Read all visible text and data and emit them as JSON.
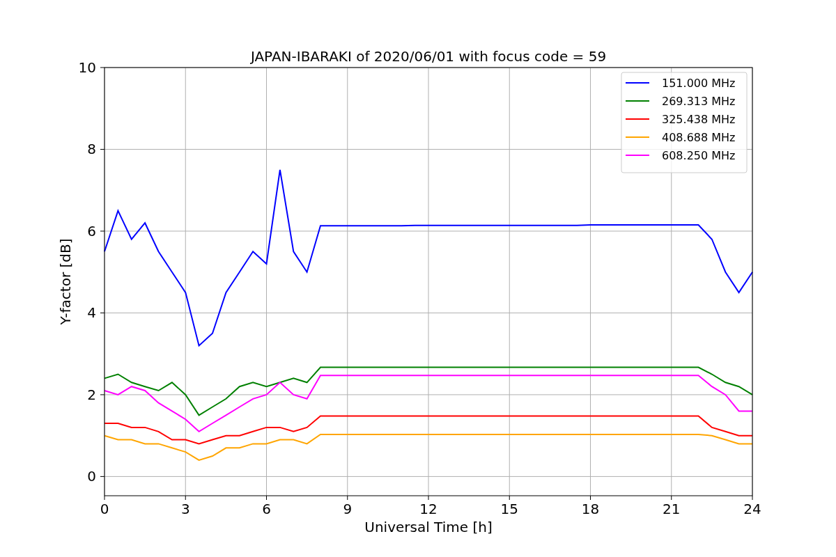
{
  "chart_data": {
    "type": "line",
    "title": "JAPAN-IBARAKI of 2020/06/01 with focus code = 59",
    "xlabel": "Universal Time [h]",
    "ylabel": "Y-factor [dB]",
    "x": [
      0,
      0.5,
      1,
      1.5,
      2,
      2.5,
      3,
      3.5,
      4,
      4.5,
      5,
      5.5,
      6,
      6.5,
      7,
      7.5,
      8,
      8.5,
      9,
      9.5,
      10,
      10.5,
      11,
      11.5,
      12,
      12.5,
      13,
      13.5,
      14,
      14.5,
      15,
      15.5,
      16,
      16.5,
      17,
      17.5,
      18,
      18.5,
      19,
      19.5,
      20,
      20.5,
      21,
      21.5,
      22,
      22.5,
      23,
      23.5,
      24
    ],
    "xlim": [
      0,
      24
    ],
    "ylim": [
      -0.47,
      10
    ],
    "grid": true,
    "legend": true,
    "xticks": [
      0,
      3,
      6,
      9,
      12,
      15,
      18,
      21,
      24
    ],
    "yticks": [
      0,
      2,
      4,
      6,
      8,
      10
    ],
    "series": [
      {
        "name": "151.000 MHz",
        "color": "#0000ff",
        "values": [
          5.5,
          6.5,
          5.8,
          6.2,
          5.5,
          5.0,
          4.5,
          3.2,
          3.5,
          4.5,
          5.0,
          5.5,
          5.2,
          7.5,
          5.5,
          5.0,
          6.13,
          6.13,
          6.13,
          6.13,
          6.13,
          6.13,
          6.13,
          6.14,
          6.14,
          6.14,
          6.14,
          6.14,
          6.14,
          6.14,
          6.14,
          6.14,
          6.14,
          6.14,
          6.14,
          6.14,
          6.15,
          6.15,
          6.15,
          6.15,
          6.15,
          6.15,
          6.15,
          6.15,
          6.15,
          5.8,
          5.0,
          4.5,
          5.0
        ]
      },
      {
        "name": "269.313 MHz",
        "color": "#008000",
        "values": [
          2.4,
          2.5,
          2.3,
          2.2,
          2.1,
          2.3,
          2.0,
          1.5,
          1.7,
          1.9,
          2.2,
          2.3,
          2.2,
          2.3,
          2.4,
          2.3,
          2.67,
          2.67,
          2.67,
          2.67,
          2.67,
          2.67,
          2.67,
          2.67,
          2.67,
          2.67,
          2.67,
          2.67,
          2.67,
          2.67,
          2.67,
          2.67,
          2.67,
          2.67,
          2.67,
          2.67,
          2.67,
          2.67,
          2.67,
          2.67,
          2.67,
          2.67,
          2.67,
          2.67,
          2.67,
          2.5,
          2.3,
          2.2,
          2.0
        ]
      },
      {
        "name": "325.438 MHz",
        "color": "#ff0000",
        "values": [
          1.3,
          1.3,
          1.2,
          1.2,
          1.1,
          0.9,
          0.9,
          0.8,
          0.9,
          1.0,
          1.0,
          1.1,
          1.2,
          1.2,
          1.1,
          1.2,
          1.48,
          1.48,
          1.48,
          1.48,
          1.48,
          1.48,
          1.48,
          1.48,
          1.48,
          1.48,
          1.48,
          1.48,
          1.48,
          1.48,
          1.48,
          1.48,
          1.48,
          1.48,
          1.48,
          1.48,
          1.48,
          1.48,
          1.48,
          1.48,
          1.48,
          1.48,
          1.48,
          1.48,
          1.48,
          1.2,
          1.1,
          1.0,
          1.0
        ]
      },
      {
        "name": "408.688 MHz",
        "color": "#ffa500",
        "values": [
          1.0,
          0.9,
          0.9,
          0.8,
          0.8,
          0.7,
          0.6,
          0.4,
          0.5,
          0.7,
          0.7,
          0.8,
          0.8,
          0.9,
          0.9,
          0.8,
          1.03,
          1.03,
          1.03,
          1.03,
          1.03,
          1.03,
          1.03,
          1.03,
          1.03,
          1.03,
          1.03,
          1.03,
          1.03,
          1.03,
          1.03,
          1.03,
          1.03,
          1.03,
          1.03,
          1.03,
          1.03,
          1.03,
          1.03,
          1.03,
          1.03,
          1.03,
          1.03,
          1.03,
          1.03,
          1.0,
          0.9,
          0.8,
          0.8
        ]
      },
      {
        "name": "608.250 MHz",
        "color": "#ff00ff",
        "values": [
          2.1,
          2.0,
          2.2,
          2.1,
          1.8,
          1.6,
          1.4,
          1.1,
          1.3,
          1.5,
          1.7,
          1.9,
          2.0,
          2.3,
          2.0,
          1.9,
          2.47,
          2.47,
          2.47,
          2.47,
          2.47,
          2.47,
          2.47,
          2.47,
          2.47,
          2.47,
          2.47,
          2.47,
          2.47,
          2.47,
          2.47,
          2.47,
          2.47,
          2.47,
          2.47,
          2.47,
          2.47,
          2.47,
          2.47,
          2.47,
          2.47,
          2.47,
          2.47,
          2.47,
          2.47,
          2.2,
          2.0,
          1.6,
          1.6
        ]
      }
    ]
  }
}
